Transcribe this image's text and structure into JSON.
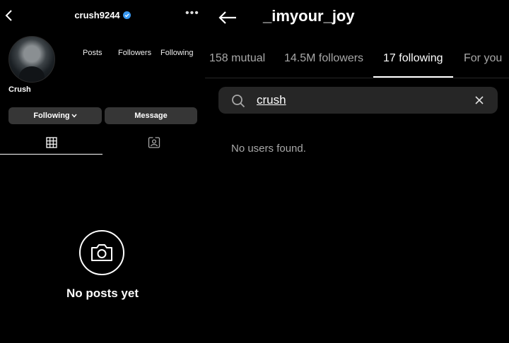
{
  "left": {
    "username": "crush9244",
    "display_name": "Crush",
    "stats": {
      "posts_label": "Posts",
      "followers_label": "Followers",
      "following_label": "Following"
    },
    "following_button": "Following",
    "message_button": "Message",
    "empty_title": "No posts yet",
    "more_icon": "more-horizontal-icon",
    "verified_color": "#3897f0"
  },
  "right": {
    "title": "_imyour_joy",
    "tabs": [
      {
        "label": "158 mutual",
        "active": false
      },
      {
        "label": "14.5M followers",
        "active": false
      },
      {
        "label": "17 following",
        "active": true
      },
      {
        "label": "For you",
        "active": false
      }
    ],
    "search_value": "crush",
    "empty_message": "No users found."
  },
  "colors": {
    "background": "#000000",
    "button": "#363636",
    "search_bg": "#262626",
    "muted_text": "#a8a8a8"
  }
}
